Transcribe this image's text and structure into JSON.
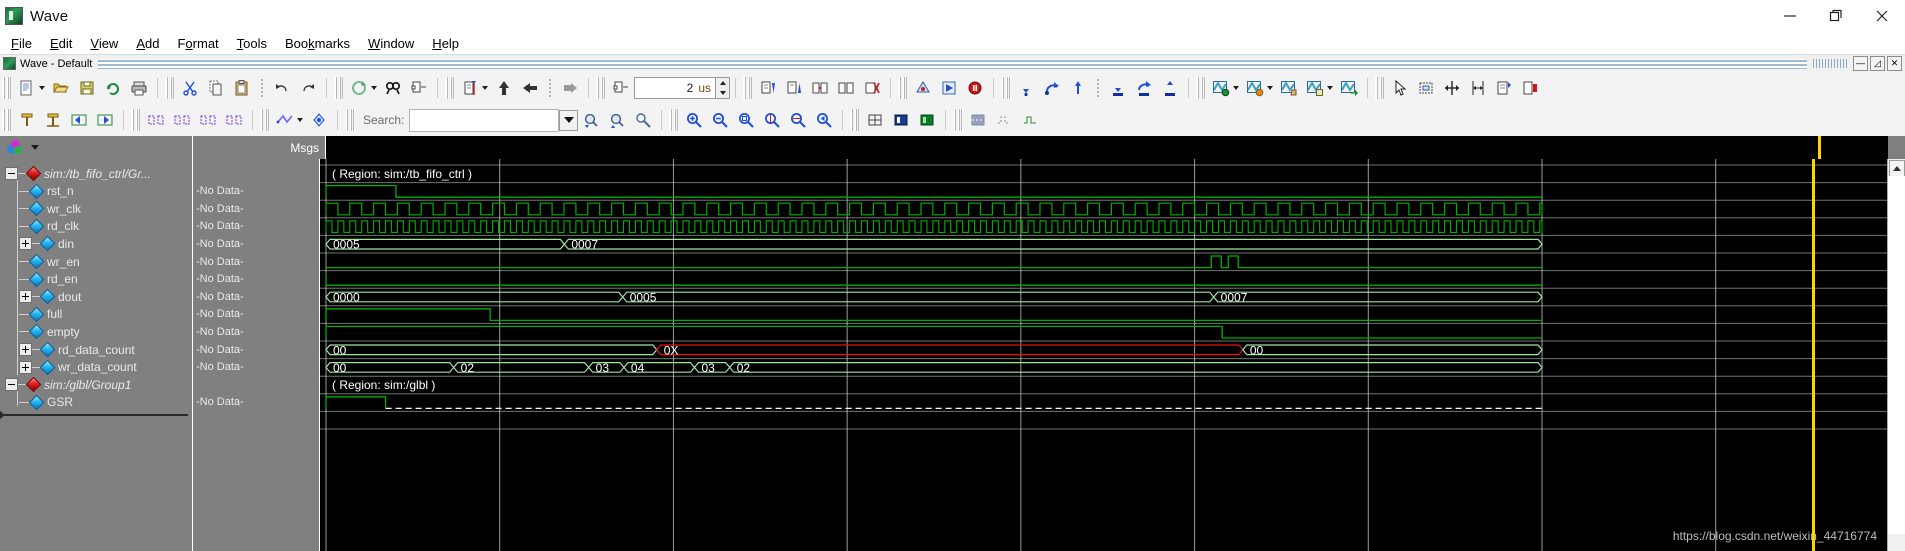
{
  "window": {
    "title": "Wave",
    "app_icon": "modelsim-icon",
    "controls": {
      "minimize": "minimize-icon",
      "restore": "restore-icon",
      "close": "close-icon"
    }
  },
  "menu": {
    "items": [
      {
        "label": "File",
        "mnemonic": "F"
      },
      {
        "label": "Edit",
        "mnemonic": "E"
      },
      {
        "label": "View",
        "mnemonic": "V"
      },
      {
        "label": "Add",
        "mnemonic": "A"
      },
      {
        "label": "Format",
        "mnemonic": "o"
      },
      {
        "label": "Tools",
        "mnemonic": "T"
      },
      {
        "label": "Bookmarks",
        "mnemonic": "k"
      },
      {
        "label": "Window",
        "mnemonic": "W"
      },
      {
        "label": "Help",
        "mnemonic": "H"
      }
    ]
  },
  "pane": {
    "caption": "Wave - Default",
    "icon": "wave-pane-icon",
    "buttons": [
      "minimize-pane",
      "restore-pane",
      "close-pane"
    ]
  },
  "toolbar1": {
    "time_value": "2",
    "time_unit": "us",
    "buttons": [
      "new-icon",
      "new-dropdown",
      "open-icon",
      "save-icon",
      "reload-icon",
      "print-icon",
      "cut-icon",
      "copy-icon",
      "paste-icon",
      "undo-icon",
      "redo-icon",
      "refresh-icon",
      "refresh-dropdown",
      "find-icon",
      "collapse-tree-icon",
      "insert-cursor-icon",
      "cursor-dropdown",
      "find-prev-transition-icon",
      "find-next-transition-icon",
      "expand-icon",
      "edit-list-icon",
      "sort-descending-icon",
      "sort-ascending-icon",
      "group-icon",
      "ungroup-icon",
      "remove-icon",
      "simulate-icon",
      "restart-icon",
      "break-icon",
      "step-icon",
      "step-over-icon",
      "step-out-icon",
      "run-icon",
      "continue-icon",
      "run-all-icon",
      "wave-new-icon",
      "wave-new-dropdown",
      "wave-open-icon",
      "wave-open-dropdown",
      "wave-edit-icon",
      "wave-save-icon",
      "wave-save-dropdown",
      "wave-export-icon",
      "select-mode-icon",
      "zoom-mode-icon",
      "pan-mode-icon",
      "measure-icon",
      "edit-mode-icon",
      "toggle-leaf-icon"
    ]
  },
  "toolbar2": {
    "search_label": "Search:",
    "search_value": "",
    "search_placeholder": "",
    "buttons": [
      "add-wave-icon",
      "remove-wave-icon",
      "move-left-icon",
      "move-right-icon",
      "group-waves-icon",
      "ungroup-waves-icon",
      "combine-icon",
      "split-icon",
      "grid-options-icon",
      "grid-dropdown",
      "radix-icon",
      "search-dropdown",
      "search-prev-icon",
      "search-next-icon",
      "search-options-icon",
      "zoom-in-icon",
      "zoom-out-icon",
      "zoom-full-icon",
      "zoom-cursor-icon",
      "zoom-range-icon",
      "zoom-last-icon",
      "wave-format-literal-icon",
      "wave-format-logic-icon",
      "wave-format-analog-icon",
      "wave-style-a-icon",
      "wave-style-b-icon",
      "wave-style-c-icon"
    ]
  },
  "wave_header": {
    "objects_icon": "objects-icon",
    "objects_dropdown": "chevron-down-icon",
    "msgs_column": "Msgs"
  },
  "signals": [
    {
      "name": "sim:/tb_fifo_ctrl/Gr...",
      "type": "group",
      "expander": "minus",
      "indent": 0,
      "msgs": "",
      "wave_row": "region1"
    },
    {
      "name": "rst_n",
      "type": "signal",
      "expander": "none",
      "indent": 1,
      "msgs": "-No Data-",
      "wave_row": "rst_n"
    },
    {
      "name": "wr_clk",
      "type": "signal",
      "expander": "none",
      "indent": 1,
      "msgs": "-No Data-",
      "wave_row": "wr_clk"
    },
    {
      "name": "rd_clk",
      "type": "signal",
      "expander": "none",
      "indent": 1,
      "msgs": "-No Data-",
      "wave_row": "rd_clk"
    },
    {
      "name": "din",
      "type": "bus",
      "expander": "plus",
      "indent": 1,
      "msgs": "-No Data-",
      "wave_row": "din"
    },
    {
      "name": "wr_en",
      "type": "signal",
      "expander": "none",
      "indent": 1,
      "msgs": "-No Data-",
      "wave_row": "wr_en"
    },
    {
      "name": "rd_en",
      "type": "signal",
      "expander": "none",
      "indent": 1,
      "msgs": "-No Data-",
      "wave_row": "rd_en"
    },
    {
      "name": "dout",
      "type": "bus",
      "expander": "plus",
      "indent": 1,
      "msgs": "-No Data-",
      "wave_row": "dout"
    },
    {
      "name": "full",
      "type": "signal",
      "expander": "none",
      "indent": 1,
      "msgs": "-No Data-",
      "wave_row": "full"
    },
    {
      "name": "empty",
      "type": "signal",
      "expander": "none",
      "indent": 1,
      "msgs": "-No Data-",
      "wave_row": "empty"
    },
    {
      "name": "rd_data_count",
      "type": "bus",
      "expander": "plus",
      "indent": 1,
      "msgs": "-No Data-",
      "wave_row": "rd_data_count"
    },
    {
      "name": "wr_data_count",
      "type": "bus",
      "expander": "plus",
      "indent": 1,
      "msgs": "-No Data-",
      "wave_row": "wr_data_count"
    },
    {
      "name": "sim:/glbl/Group1",
      "type": "group",
      "expander": "minus",
      "indent": 0,
      "msgs": "",
      "wave_row": "region2"
    },
    {
      "name": "GSR",
      "type": "signal",
      "expander": "none",
      "indent": 1,
      "msgs": "-No Data-",
      "wave_row": "gsr"
    }
  ],
  "wave": {
    "region_labels": [
      {
        "text": "( Region: sim:/tb_fifo_ctrl )",
        "row": 0
      },
      {
        "text": "( Region: sim:/glbl )",
        "row": 12
      }
    ],
    "bus_values": {
      "din": [
        {
          "value": "0005",
          "x": 0.0
        },
        {
          "value": "0007",
          "x": 0.196
        }
      ],
      "dout": [
        {
          "value": "0000",
          "x": 0.0
        },
        {
          "value": "0005",
          "x": 0.244
        },
        {
          "value": "0007",
          "x": 0.73
        }
      ],
      "rd_data_count": [
        {
          "value": "00",
          "x": 0.0
        },
        {
          "value": "0X",
          "x": 0.272
        },
        {
          "value": "00",
          "x": 0.754
        }
      ],
      "wr_data_count": [
        {
          "value": "00",
          "x": 0.0
        },
        {
          "value": "02",
          "x": 0.105
        },
        {
          "value": "03",
          "x": 0.216
        },
        {
          "value": "04",
          "x": 0.245
        },
        {
          "value": "03",
          "x": 0.303
        },
        {
          "value": "02",
          "x": 0.332
        }
      ]
    },
    "colors": {
      "signal_green": "#00b000",
      "bus_outline": "#9fe3a0",
      "bus_error_red": "#e81010",
      "grid": "#c9d6c9",
      "background": "#000000",
      "cursor": "#ffd400",
      "panel_gray": "#808080",
      "text_light": "#e9e9e9"
    },
    "cursor_x": 0.952
  },
  "watermark": "https://blog.csdn.net/weixin_44716774"
}
